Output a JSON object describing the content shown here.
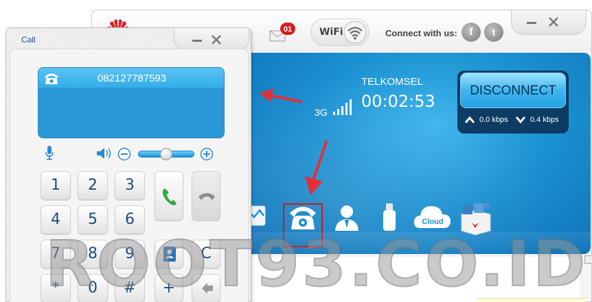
{
  "main_window": {
    "message_badge": "01",
    "wifi_label": "WiFi",
    "connect_with_us": "Connect with us:",
    "facebook_glyph": "f",
    "twitter_glyph": "t"
  },
  "dashboard": {
    "operator": "TELKOMSEL",
    "network_type": "3G",
    "duration": "00:02:53",
    "disconnect_label": "DISCONNECT",
    "upload_speed": "0.0 kbps",
    "download_speed": "0.4 kbps",
    "toolbar": [
      {
        "name": "statistics",
        "icon": "statistics-icon"
      },
      {
        "name": "call",
        "icon": "phone-icon"
      },
      {
        "name": "contacts",
        "icon": "user-icon"
      },
      {
        "name": "usb-storage",
        "icon": "usb-icon"
      },
      {
        "name": "cloud",
        "icon": "cloud-icon",
        "label": "Cloud"
      },
      {
        "name": "apps",
        "icon": "app-box-icon"
      }
    ]
  },
  "call_window": {
    "title": "Call",
    "number": "082127787593",
    "volume_level": 0.5,
    "keys": [
      "1",
      "2",
      "3",
      "4",
      "5",
      "6",
      "7",
      "8",
      "9",
      "*",
      "0",
      "#"
    ],
    "clear_label": "C",
    "plus_label": "+"
  },
  "watermark": "ROOT93.CO.ID",
  "colors": {
    "accent_blue": "#2a98d6",
    "highlight_red": "#d01a1a",
    "call_green": "#3aa645"
  }
}
